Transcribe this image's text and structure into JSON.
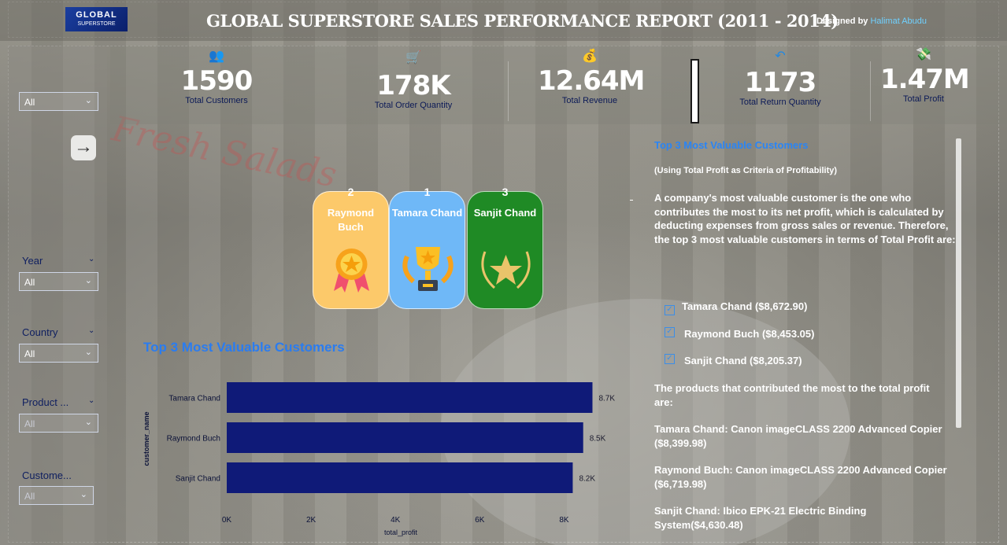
{
  "header": {
    "logo_main": "GLOBAL",
    "logo_sub": "SUPERSTORE",
    "title": "GLOBAL SUPERSTORE SALES PERFORMANCE REPORT (2011 - 2014)",
    "designed_by": "Designed by",
    "author": "Halimat Abudu"
  },
  "sidebar": {
    "top_dropdown": "All",
    "slicers": [
      {
        "label": "Year",
        "value": "All"
      },
      {
        "label": "Country",
        "value": "All"
      },
      {
        "label": "Product ...",
        "value": "All"
      },
      {
        "label": "Custome...",
        "value": "All"
      }
    ]
  },
  "kpis": [
    {
      "icon": "users-icon",
      "value": "1590",
      "label": "Total Customers"
    },
    {
      "icon": "cart-icon",
      "value": "178K",
      "label": "Total Order Quantity"
    },
    {
      "icon": "money-icon",
      "value": "12.64M",
      "label": "Total Revenue"
    },
    {
      "icon": "return-icon",
      "value": "1173",
      "label": "Total Return Quantity"
    },
    {
      "icon": "profit-icon",
      "value": "1.47M",
      "label": "Total Profit"
    }
  ],
  "badges": [
    {
      "rank": "2",
      "name": "Raymond Buch",
      "color": "#fcc96a"
    },
    {
      "rank": "1",
      "name": "Tamara Chand",
      "color": "#6fb8f7"
    },
    {
      "rank": "3",
      "name": "Sanjit Chand",
      "color": "#1f8a25"
    }
  ],
  "chart_data": {
    "type": "bar",
    "orientation": "horizontal",
    "title": "Top 3 Most Valuable Customers",
    "categories": [
      "Tamara Chand",
      "Raymond Buch",
      "Sanjit Chand"
    ],
    "values": [
      8672.9,
      8453.05,
      8205.37
    ],
    "data_labels": [
      "8.7K",
      "8.5K",
      "8.2K"
    ],
    "xlabel": "total_profit",
    "ylabel": "customer_name",
    "xlim": [
      0,
      9000
    ],
    "x_ticks": [
      0,
      2000,
      4000,
      6000,
      8000
    ],
    "x_tick_labels": [
      "0K",
      "2K",
      "4K",
      "6K",
      "8K"
    ],
    "bar_color": "#0f1a78",
    "grid": false
  },
  "panel": {
    "title": "Top 3 Most Valuable Customers",
    "subtitle": "(Using Total Profit as Criteria of Profitability)",
    "intro": "A company's most valuable customer is the one who contributes the most to its net profit, which is calculated by deducting expenses from gross sales or revenue. Therefore, the top 3 most valuable customers in terms of Total Profit are:",
    "checklist": [
      "Tamara Chand ($8,672.90)",
      "Raymond Buch ($8,453.05)",
      "Sanjit Chand ($8,205.37)"
    ],
    "products_intro": "The products that contributed the most to the total profit are:",
    "products": [
      "Tamara Chand: Canon imageCLASS 2200 Advanced Copier ($8,399.98)",
      "Raymond Buch: Canon imageCLASS 2200 Advanced Copier ($6,719.98)",
      "Sanjit Chand: Ibico EPK-21 Electric Binding System($4,630.48)"
    ]
  }
}
